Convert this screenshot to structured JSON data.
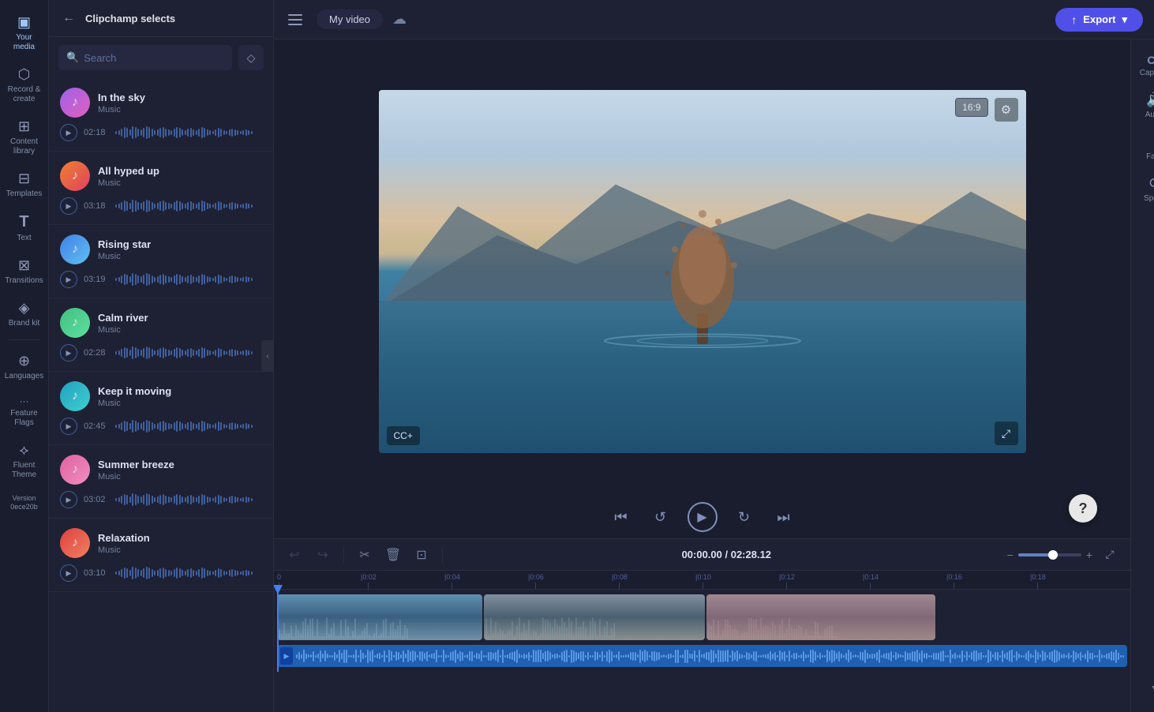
{
  "app": {
    "title": "Clipchamp selects",
    "hamburger_label": "Menu"
  },
  "topbar": {
    "project_name": "My video",
    "export_label": "Export"
  },
  "sidebar": {
    "items": [
      {
        "id": "your-media",
        "label": "Your media",
        "icon": "▣"
      },
      {
        "id": "record-create",
        "label": "Record &\ncreate",
        "icon": "⬡"
      },
      {
        "id": "content-library",
        "label": "Content library",
        "icon": "⊞"
      },
      {
        "id": "templates",
        "label": "Templates",
        "icon": "⊟"
      },
      {
        "id": "text",
        "label": "Text",
        "icon": "T"
      },
      {
        "id": "transitions",
        "label": "Transitions",
        "icon": "⊠"
      },
      {
        "id": "brand-kit",
        "label": "Brand kit",
        "icon": "◈"
      },
      {
        "id": "languages",
        "label": "Languages",
        "icon": "⊕"
      },
      {
        "id": "feature-flags",
        "label": "Feature flags",
        "icon": "···"
      },
      {
        "id": "fluent-theme",
        "label": "Fluent theme",
        "icon": "⟡"
      },
      {
        "id": "version",
        "label": "Version\n0ece20b",
        "icon": ""
      }
    ]
  },
  "panel": {
    "back_label": "←",
    "title": "Clipchamp selects",
    "search_placeholder": "Search",
    "filter_icon": "◇"
  },
  "music_list": [
    {
      "id": "in-the-sky",
      "name": "In the sky",
      "type": "Music",
      "duration": "02:18",
      "icon_class": "purple"
    },
    {
      "id": "all-hyped-up",
      "name": "All hyped up",
      "type": "Music",
      "duration": "03:18",
      "icon_class": "orange"
    },
    {
      "id": "rising-star",
      "name": "Rising star",
      "type": "Music",
      "duration": "03:19",
      "icon_class": "blue"
    },
    {
      "id": "calm-river",
      "name": "Calm river",
      "type": "Music",
      "duration": "02:28",
      "icon_class": "green"
    },
    {
      "id": "keep-it-moving",
      "name": "Keep it moving",
      "type": "Music",
      "duration": "02:45",
      "icon_class": "teal"
    },
    {
      "id": "summer-breeze",
      "name": "Summer breeze",
      "type": "Music",
      "duration": "03:02",
      "icon_class": "pink"
    },
    {
      "id": "relaxation",
      "name": "Relaxation",
      "type": "Music",
      "duration": "03:10",
      "icon_class": "red"
    }
  ],
  "right_panel": {
    "items": [
      {
        "id": "captions",
        "label": "Captions",
        "icon": "CC"
      },
      {
        "id": "audio",
        "label": "Audio",
        "icon": "🔊"
      },
      {
        "id": "fade",
        "label": "Fade",
        "icon": "◑"
      },
      {
        "id": "speed",
        "label": "Speed",
        "icon": "⟳"
      }
    ]
  },
  "player": {
    "current_time": "00:00.00",
    "total_time": "02:28.12",
    "aspect_ratio": "16:9"
  },
  "timeline": {
    "time_display": "00:00.00 / 02:28.12",
    "ruler_marks": [
      "0",
      "|0:02",
      "|0:04",
      "|0:06",
      "|0:08",
      "|0:10",
      "|0:12",
      "|0:14",
      "|0:16",
      "|0:18"
    ],
    "zoom_level": 55
  },
  "controls": {
    "skip_back": "⏮",
    "back_5": "↺",
    "play": "▶",
    "forward_5": "↻",
    "skip_forward": "⏭",
    "captions_plus": "CC+"
  }
}
